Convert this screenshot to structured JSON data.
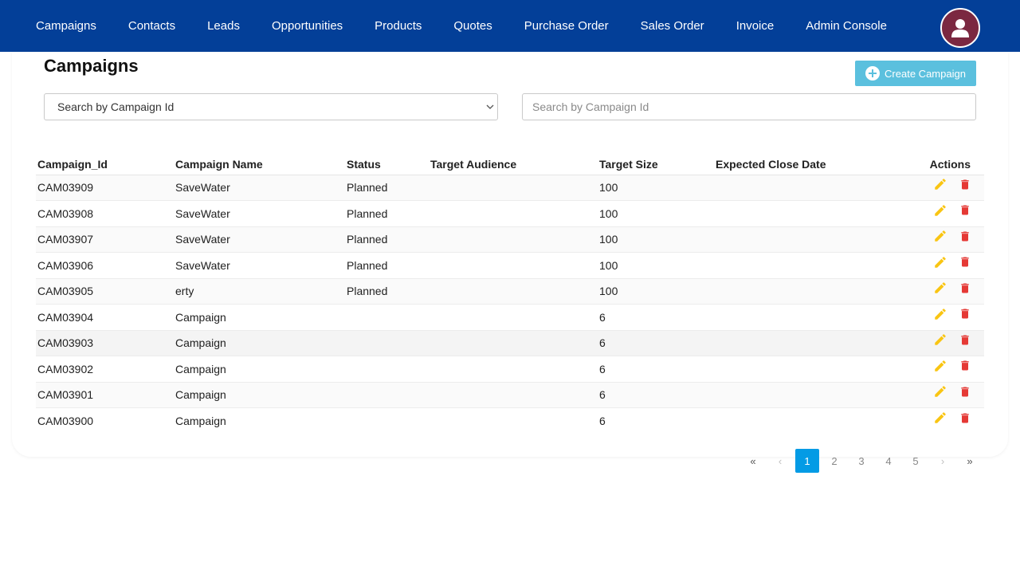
{
  "nav": {
    "items": [
      "Campaigns",
      "Contacts",
      "Leads",
      "Opportunities",
      "Products",
      "Quotes",
      "Purchase Order",
      "Sales Order",
      "Invoice",
      "Admin Console"
    ]
  },
  "user": {
    "icon": "user-avatar-icon"
  },
  "page": {
    "title": "Campaigns"
  },
  "toolbar": {
    "create_label": "Create Campaign",
    "create_icon": "plus-circle-icon",
    "accent": "#5bc0de"
  },
  "filter": {
    "selected": "Search by Campaign Id"
  },
  "search": {
    "placeholder": "Search by Campaign Id",
    "value": ""
  },
  "table": {
    "headers": [
      "Campaign_Id",
      "Campaign Name",
      "Status",
      "Target Audience",
      "Target Size",
      "Expected Close Date",
      "Actions"
    ],
    "rows": [
      [
        "CAM03909",
        "SaveWater",
        "Planned",
        "",
        "100",
        ""
      ],
      [
        "CAM03908",
        "SaveWater",
        "Planned",
        "",
        "100",
        ""
      ],
      [
        "CAM03907",
        "SaveWater",
        "Planned",
        "",
        "100",
        ""
      ],
      [
        "CAM03906",
        "SaveWater",
        "Planned",
        "",
        "100",
        ""
      ],
      [
        "CAM03905",
        "erty",
        "Planned",
        "",
        "100",
        ""
      ],
      [
        "CAM03904",
        "Campaign",
        "",
        "",
        "6",
        ""
      ],
      [
        "CAM03903",
        "Campaign",
        "",
        "",
        "6",
        ""
      ],
      [
        "CAM03902",
        "Campaign",
        "",
        "",
        "6",
        ""
      ],
      [
        "CAM03901",
        "Campaign",
        "",
        "",
        "6",
        ""
      ],
      [
        "CAM03900",
        "Campaign",
        "",
        "",
        "6",
        ""
      ]
    ],
    "edit_icon": "pencil-icon",
    "delete_icon": "trash-icon",
    "edit_color": "#f9c513",
    "delete_color": "#e53935"
  },
  "pagination": {
    "first": "«",
    "prev": "‹",
    "pages": [
      "1",
      "2",
      "3",
      "4",
      "5"
    ],
    "active": "1",
    "next": "›",
    "last": "»",
    "active_color": "#039be5"
  },
  "colors": {
    "topbar": "#033f98",
    "avatar": "#7b2841"
  }
}
